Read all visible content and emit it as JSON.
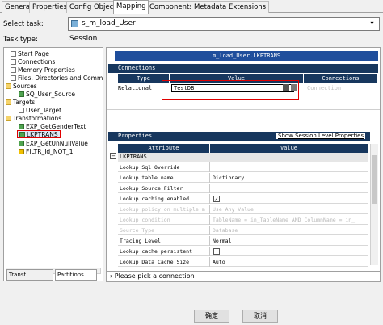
{
  "tabs": [
    "General",
    "Properties",
    "Config Object",
    "Mapping",
    "Components",
    "Metadata Extensions"
  ],
  "active_tab": "Mapping",
  "select_task_label": "Select task:",
  "selected_task": "s_m_load_User",
  "task_type_label": "Task type:",
  "task_type_value": "Session",
  "tree": {
    "start_page": "Start Page",
    "connections": "Connections",
    "memory_properties": "Memory Properties",
    "files_dirs": "Files, Directories and Command",
    "sources": "Sources",
    "sq_user_source": "SQ_User_Source",
    "targets": "Targets",
    "user_target": "User_Target",
    "transformations": "Transformations",
    "exp_getgender": "EXP_GetGenderText",
    "lkptrans": "LKPTRANS",
    "exp_getunnull": "EXP_GetUnNullValue",
    "filtr": "FILTR_Id_NOT_1"
  },
  "bottom_tabs": [
    "Transf...",
    "Partitions"
  ],
  "panel_title": "m_load_User.LKPTRANS",
  "connections": {
    "section": "Connections",
    "headers": [
      "Type",
      "Value",
      "Connections"
    ],
    "type": "Relational",
    "value": "TestDB",
    "conn_hint": "Connection"
  },
  "properties": {
    "section": "Properties",
    "show_session_link": "Show Session Level Properties",
    "headers": [
      "Attribute",
      "Value"
    ],
    "group": "LKPTRANS",
    "rows": [
      {
        "attr": "Lookup Sql Override",
        "val": ""
      },
      {
        "attr": "Lookup table name",
        "val": "Dictionary"
      },
      {
        "attr": "Lookup Source Filter",
        "val": ""
      },
      {
        "attr": "Lookup caching enabled",
        "val": ""
      },
      {
        "attr": "Lookup policy on multiple m",
        "val": "Use Any Value"
      },
      {
        "attr": "Lookup condition",
        "val": "TableName = in_TableName AND ColumnName = in_"
      },
      {
        "attr": "Source Type",
        "val": "Database"
      },
      {
        "attr": "Tracing Level",
        "val": "Normal"
      },
      {
        "attr": "Lookup cache persistent",
        "val": ""
      },
      {
        "attr": "Lookup Data Cache Size",
        "val": "Auto"
      }
    ]
  },
  "status_text": "Please pick a connection",
  "buttons": {
    "ok": "确定",
    "cancel": "取消"
  }
}
